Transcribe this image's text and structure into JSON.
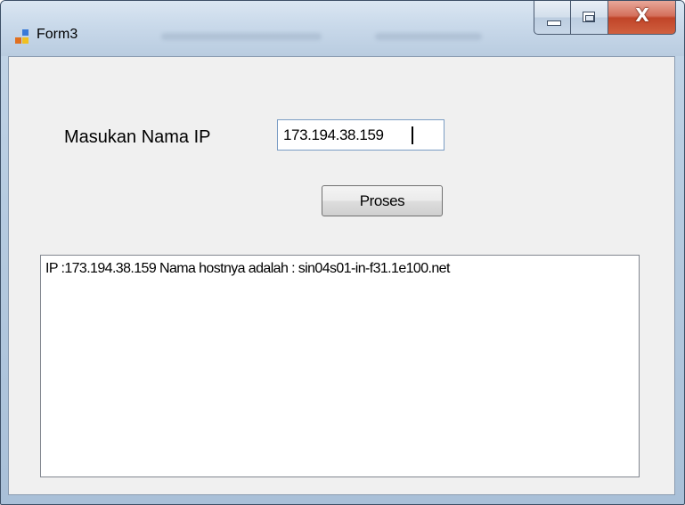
{
  "window": {
    "title": "Form3",
    "icon": "windows-form-icon",
    "caption_buttons": [
      "minimize-icon",
      "maximize-icon",
      "close-icon"
    ],
    "close_glyph": "X"
  },
  "form": {
    "ip_label": "Masukan Nama IP",
    "ip_value": "173.194.38.159",
    "submit_label": "Proses",
    "result_text": "IP :173.194.38.159 Nama hostnya adalah : sin04s01-in-f31.1e100.net"
  },
  "colors": {
    "client_background": "#f0f0f0",
    "input_border": "#7a9cc4",
    "close_button": "#c04428"
  }
}
